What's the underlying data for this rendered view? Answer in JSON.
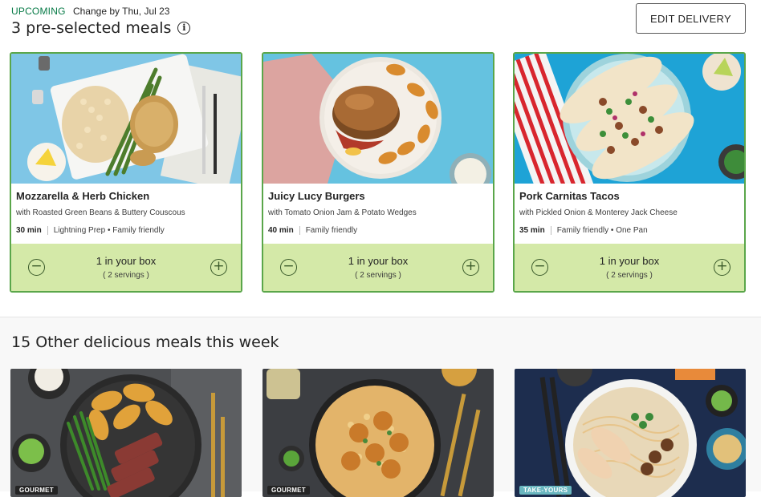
{
  "delivery": {
    "status": "UPCOMING",
    "change_by": "Change by Thu, Jul 23",
    "title": "3 pre-selected meals",
    "info_icon": "i",
    "edit_label": "EDIT DELIVERY"
  },
  "selected_meals": [
    {
      "name": "Mozzarella & Herb Chicken",
      "subtitle": "with Roasted Green Beans & Buttery Couscous",
      "time": "30 min",
      "tags": "Lightning Prep • Family friendly",
      "quantity": "1 in your box",
      "servings": "( 2 servings )"
    },
    {
      "name": "Juicy Lucy Burgers",
      "subtitle": "with Tomato Onion Jam & Potato Wedges",
      "time": "40 min",
      "tags": "Family friendly",
      "quantity": "1 in your box",
      "servings": "( 2 servings )"
    },
    {
      "name": "Pork Carnitas Tacos",
      "subtitle": "with Pickled Onion & Monterey Jack Cheese",
      "time": "35 min",
      "tags": "Family friendly • One Pan",
      "quantity": "1 in your box",
      "servings": "( 2 servings )"
    }
  ],
  "controls": {
    "minus": "−",
    "plus": "+"
  },
  "other": {
    "title": "15 Other delicious meals this week",
    "tiles": [
      {
        "tag": "GOURMET"
      },
      {
        "tag": "GOURMET"
      },
      {
        "tag": "TAKE-YOURS"
      }
    ]
  },
  "colors": {
    "accent_green": "#067a46",
    "card_border": "#5aa64a",
    "box_bg": "#d4e9a8",
    "tag_dark": "#242424",
    "tag_teal": "#6ab7c0"
  }
}
